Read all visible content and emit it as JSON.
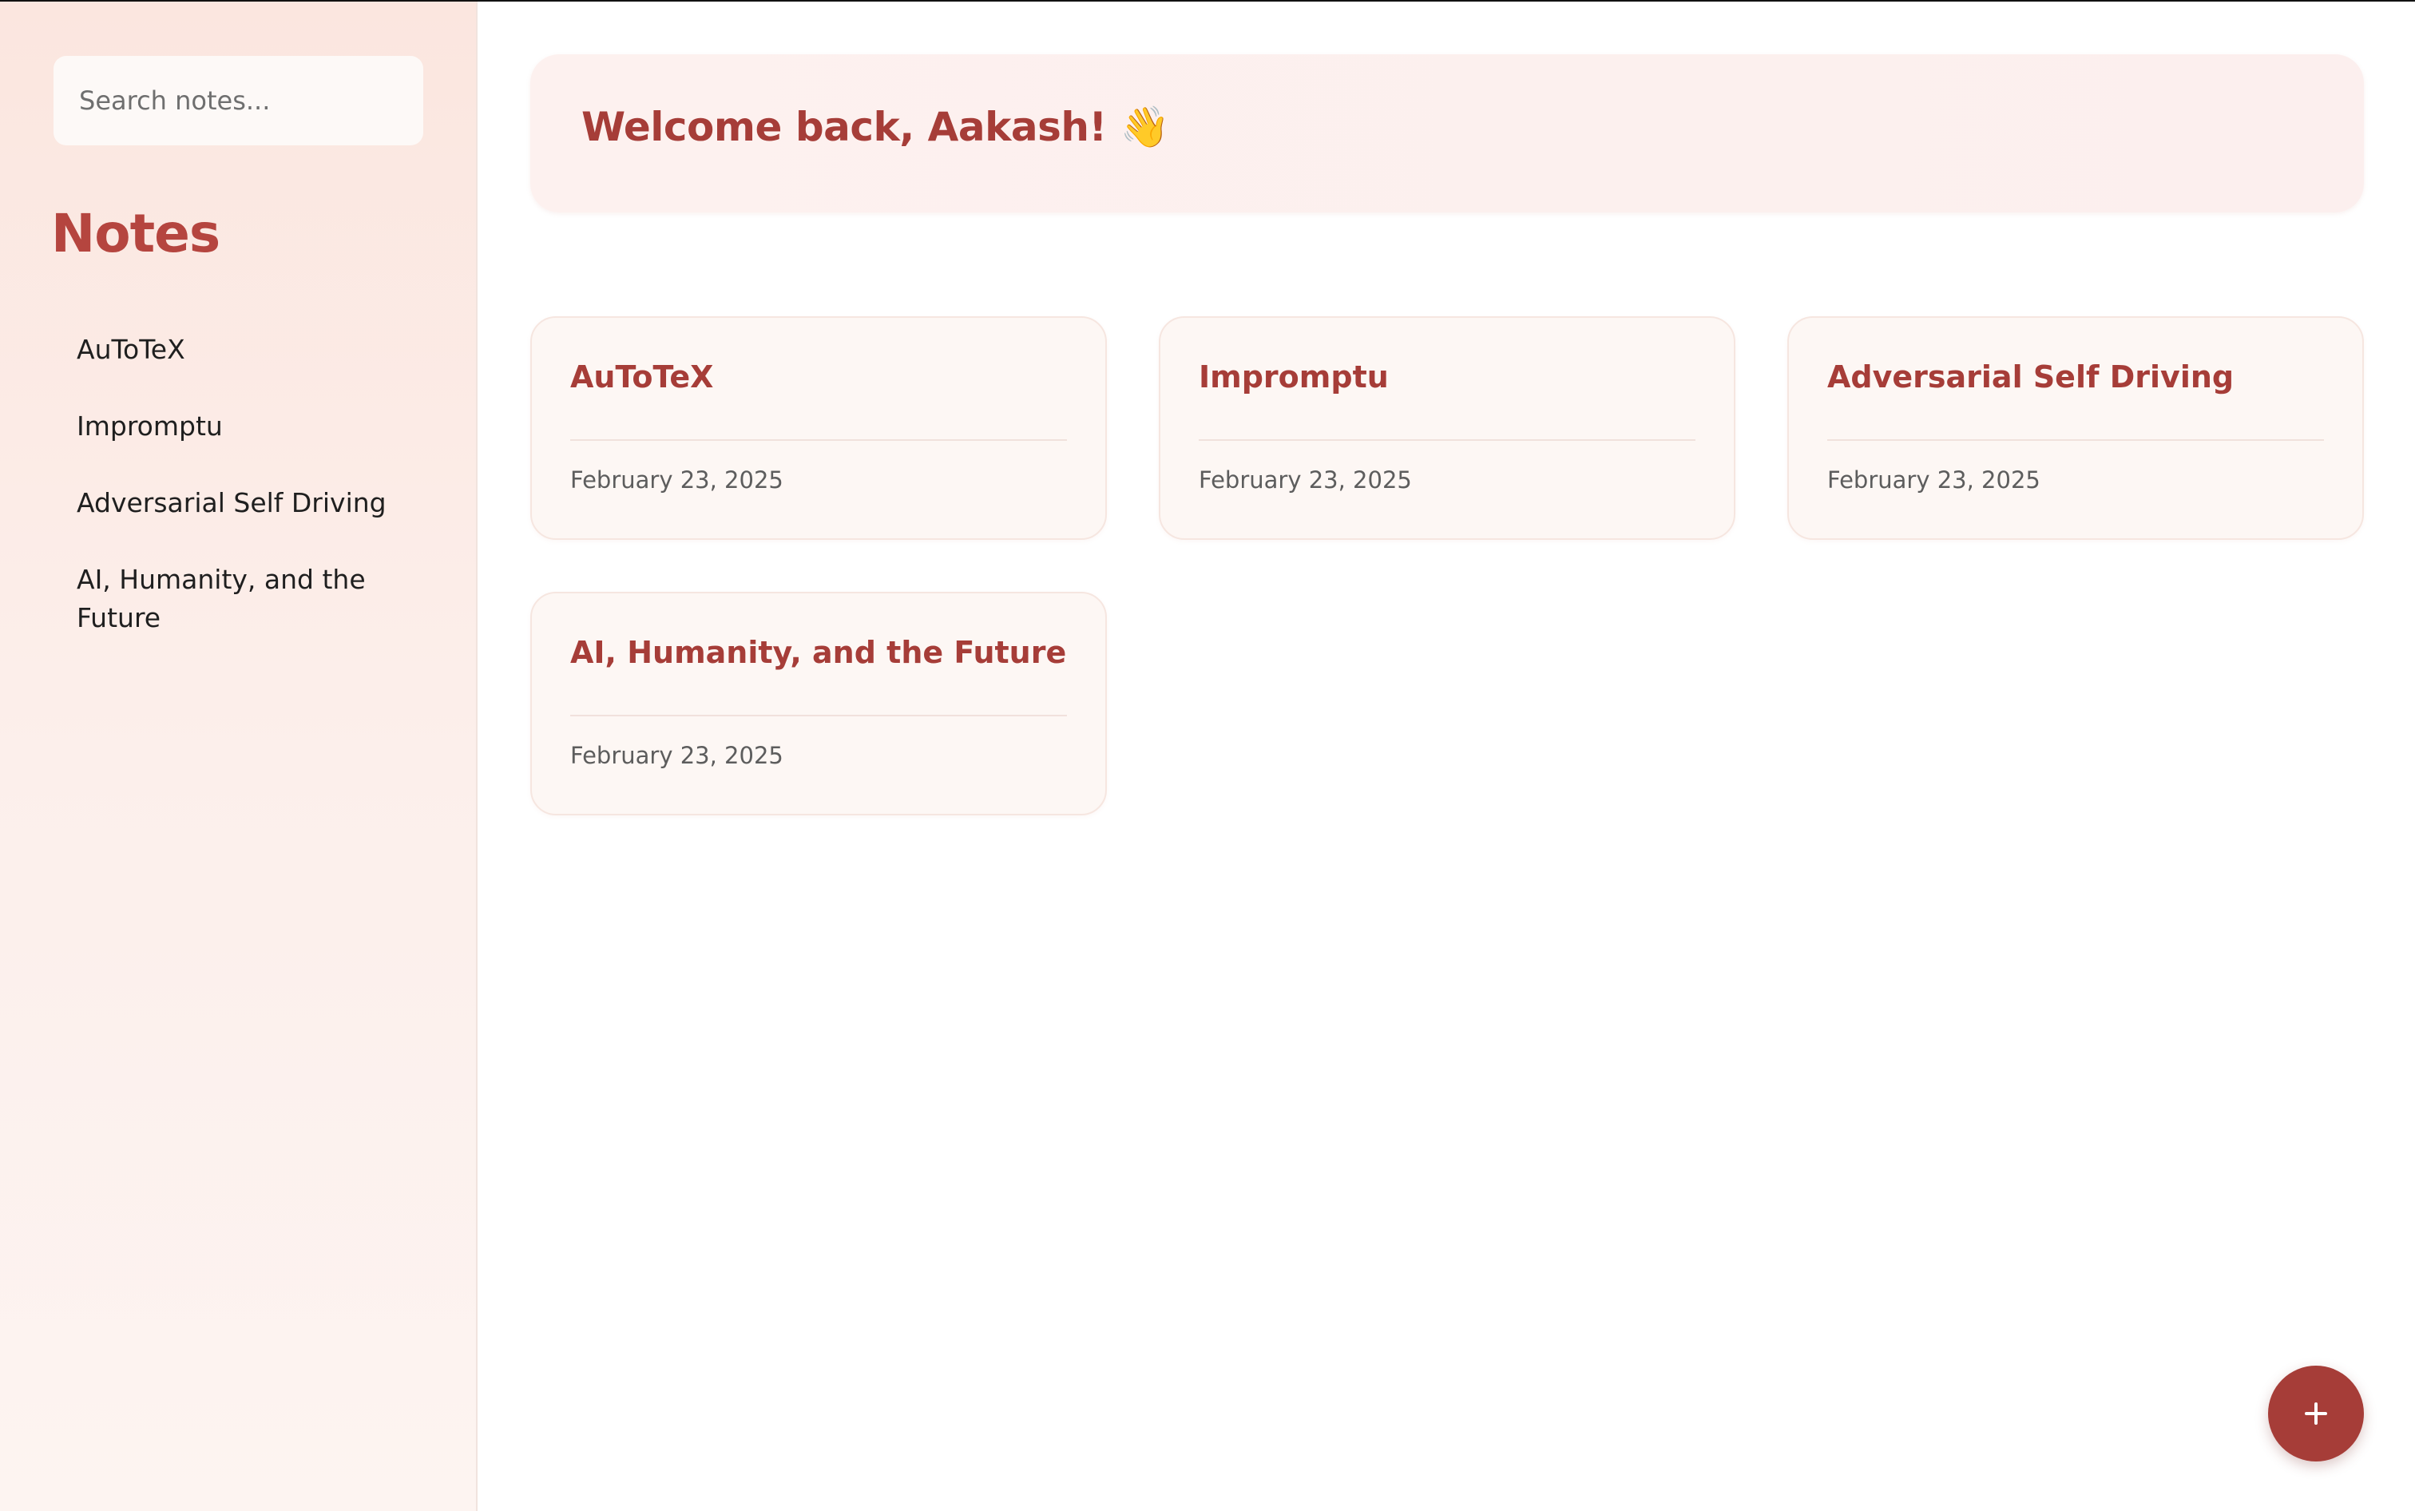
{
  "sidebar": {
    "search_placeholder": "Search notes...",
    "title": "Notes",
    "items": [
      {
        "label": "AuToTeX"
      },
      {
        "label": "Impromptu"
      },
      {
        "label": "Adversarial Self Driving"
      },
      {
        "label": "AI, Humanity, and the Future"
      }
    ]
  },
  "main": {
    "welcome": "Welcome back, Aakash! 👋",
    "cards": [
      {
        "title": "AuToTeX",
        "date": "February 23, 2025"
      },
      {
        "title": "Impromptu",
        "date": "February 23, 2025"
      },
      {
        "title": "Adversarial Self Driving",
        "date": "February 23, 2025"
      },
      {
        "title": "AI, Humanity, and the Future",
        "date": "February 23, 2025"
      }
    ]
  },
  "fab": {
    "icon": "plus-icon"
  },
  "colors": {
    "accent": "#a63d38",
    "sidebar_bg": "#fbe6df",
    "card_bg": "#fdf7f4"
  }
}
